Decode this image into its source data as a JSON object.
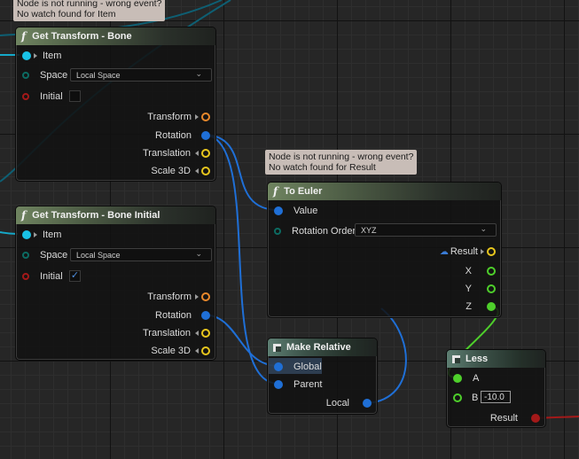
{
  "tooltips": {
    "item": [
      "Node is not running - wrong event?",
      "No watch found for Item"
    ],
    "result": [
      "Node is not running - wrong event?",
      "No watch found for Result"
    ]
  },
  "nodes": {
    "get_transform_bone": {
      "title": "Get Transform - Bone",
      "pins": {
        "item": "Item",
        "space": "Space",
        "initial": "Initial",
        "transform": "Transform",
        "rotation": "Rotation",
        "translation": "Translation",
        "scale3d": "Scale 3D"
      },
      "space_value": "Local Space",
      "initial_checked": false
    },
    "get_transform_bone_initial": {
      "title": "Get Transform - Bone Initial",
      "pins": {
        "item": "Item",
        "space": "Space",
        "initial": "Initial",
        "transform": "Transform",
        "rotation": "Rotation",
        "translation": "Translation",
        "scale3d": "Scale 3D"
      },
      "space_value": "Local Space",
      "initial_checked": true,
      "check_glyph": "✓"
    },
    "to_euler": {
      "title": "To Euler",
      "pins": {
        "value": "Value",
        "rotation_order": "Rotation Order",
        "result": "Result",
        "x": "X",
        "y": "Y",
        "z": "Z"
      },
      "rotation_order_value": "XYZ"
    },
    "make_relative": {
      "title": "Make Relative",
      "pins": {
        "global": "Global",
        "parent": "Parent",
        "local": "Local"
      }
    },
    "less": {
      "title": "Less",
      "pins": {
        "a": "A",
        "b": "B",
        "result": "Result"
      },
      "b_value": "-10.0"
    }
  },
  "icons": {
    "function": "f",
    "chevron": "⌄"
  },
  "colors": {
    "exec_cyan": "#19c2e6",
    "rotator_blue": "#1f6fd6",
    "transform_orange": "#e8882b",
    "vector_yellow": "#e8c61d",
    "float_green": "#4ecf2b",
    "bool_red": "#a31919",
    "enum_teal": "#0c6b62"
  }
}
